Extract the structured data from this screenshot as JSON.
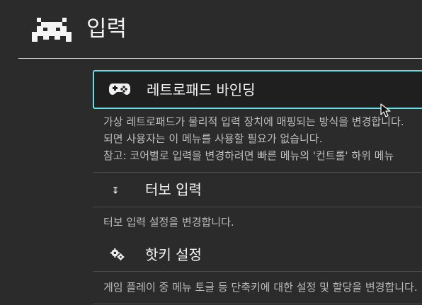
{
  "header": {
    "title": "입력",
    "logo_icon": "space-invader-icon"
  },
  "menu": {
    "items": [
      {
        "label": "레트로패드 바인딩",
        "icon": "gamepad-icon",
        "description_lines": [
          "가상 레트로패드가 물리적 입력 장치에 매핑되는 방식을 변경합니다.",
          "되면 사용자는 이 메뉴를 사용할 필요가 없습니다.",
          "참고: 코어별로 입력을 변경하려면 빠른 메뉴의 '컨트롤' 하위 메뉴"
        ]
      },
      {
        "label": "터보 입력",
        "icon": "turbo-arrow-icon",
        "description_lines": [
          "터보 입력 설정을 변경합니다."
        ]
      },
      {
        "label": "핫키 설정",
        "icon": "gears-icon",
        "description_lines": [
          "게임 플레이 중 메뉴 토글 등 단축키에 대한 설정 및 할당을 변경합니다."
        ]
      }
    ]
  },
  "colors": {
    "background": "#2b2b2b",
    "selected_bg": "#1f1f1f",
    "selected_border": "#66e0e6",
    "text_primary": "#f3f3f3",
    "text_secondary": "#bdbdbd"
  }
}
